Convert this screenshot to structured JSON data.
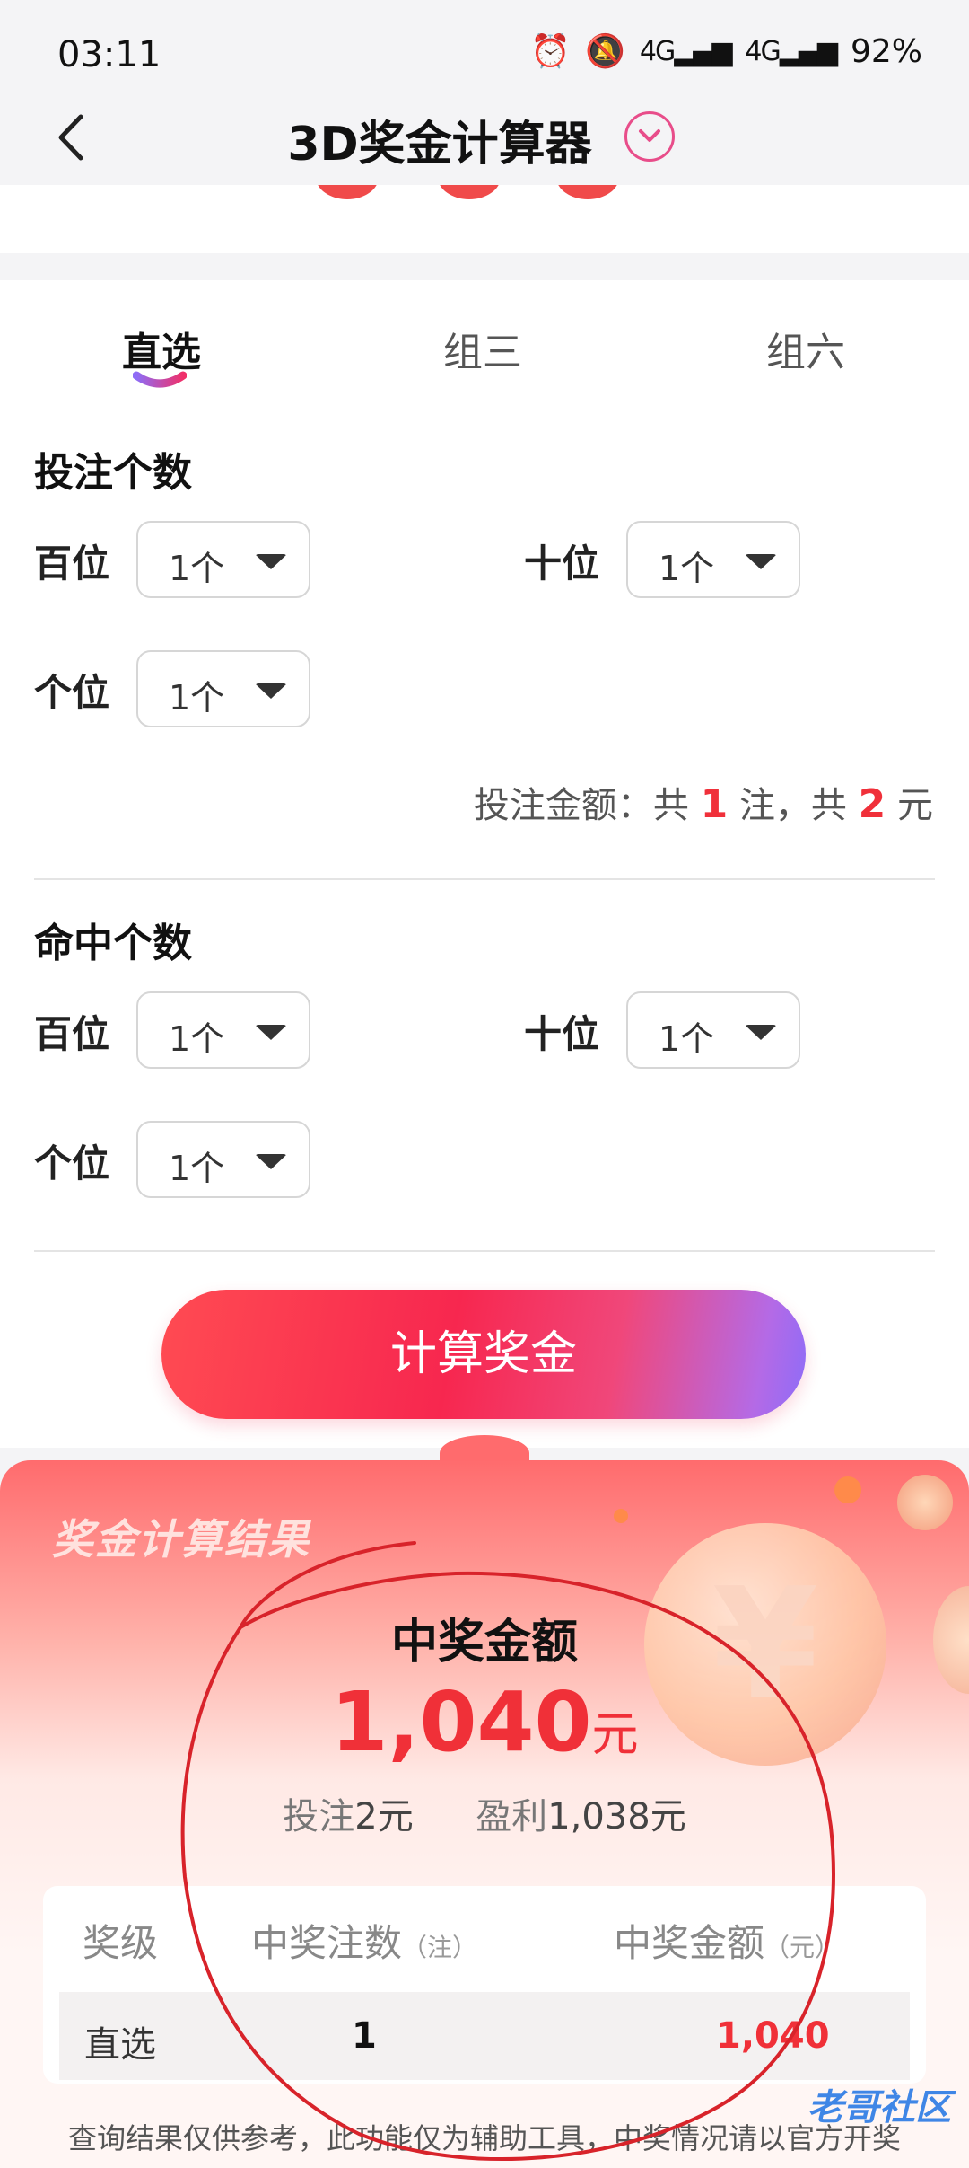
{
  "status": {
    "time": "03:11",
    "battery": "92%",
    "net1": "4G",
    "net2": "4G"
  },
  "nav": {
    "title": "3D奖金计算器"
  },
  "tabs": [
    "直选",
    "组三",
    "组六"
  ],
  "bet": {
    "title": "投注个数",
    "rows": [
      {
        "label": "百位",
        "value": "1个"
      },
      {
        "label": "十位",
        "value": "1个"
      },
      {
        "label": "个位",
        "value": "1个"
      }
    ],
    "summary": {
      "prefix": "投注金额：共",
      "count": "1",
      "mid": "注，共",
      "amount": "2",
      "suffix": "元"
    }
  },
  "hit": {
    "title": "命中个数",
    "rows": [
      {
        "label": "百位",
        "value": "1个"
      },
      {
        "label": "十位",
        "value": "1个"
      },
      {
        "label": "个位",
        "value": "1个"
      }
    ]
  },
  "calc_button": "计算奖金",
  "result": {
    "label": "奖金计算结果",
    "title": "中奖金额",
    "amount": "1,040",
    "unit": "元",
    "bet_label": "投注",
    "bet_value": "2元",
    "profit_label": "盈利",
    "profit_value": "1,038元",
    "table": {
      "headers": [
        "奖级",
        "中奖注数",
        "中奖金额"
      ],
      "header_units": [
        "",
        "（注）",
        "（元）"
      ],
      "row": {
        "level": "直选",
        "count": "1",
        "amount": "1,040"
      }
    },
    "footnote_line1": "查询结果仅供参考，此功能仅为辅助工具，中奖情况请以官方开奖",
    "watermark": "老哥社区"
  },
  "colors": {
    "accent_red": "#f03038",
    "tab_indicator": "#a45cf0"
  }
}
